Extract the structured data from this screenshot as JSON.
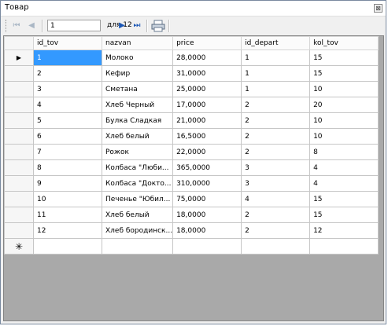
{
  "window": {
    "title": "Товар",
    "close_symbol": "⊠"
  },
  "navigator": {
    "position": "1",
    "count_label": "для 12",
    "buttons": {
      "first": "⏮",
      "prev": "◀",
      "next": "▶",
      "last": "⏭"
    }
  },
  "grid": {
    "columns": [
      "id_tov",
      "nazvan",
      "price",
      "id_depart",
      "kol_tov"
    ],
    "rows": [
      [
        "1",
        "Молоко",
        "28,0000",
        "1",
        "15"
      ],
      [
        "2",
        "Кефир",
        "31,0000",
        "1",
        "15"
      ],
      [
        "3",
        "Сметана",
        "25,0000",
        "1",
        "10"
      ],
      [
        "4",
        "Хлеб Черный",
        "17,0000",
        "2",
        "20"
      ],
      [
        "5",
        "Булка Сладкая",
        "21,0000",
        "2",
        "10"
      ],
      [
        "6",
        "Хлеб белый",
        "16,5000",
        "2",
        "10"
      ],
      [
        "7",
        "Рожок",
        "22,0000",
        "2",
        "8"
      ],
      [
        "8",
        "Колбаса \"Люби...",
        "365,0000",
        "3",
        "4"
      ],
      [
        "9",
        "Колбаса \"Докто...",
        "310,0000",
        "3",
        "4"
      ],
      [
        "10",
        "Печенье \"Юбил...",
        "75,0000",
        "4",
        "15"
      ],
      [
        "11",
        "Хлеб белый",
        "18,0000",
        "2",
        "15"
      ],
      [
        "12",
        "Хлеб бородинск...",
        "18,0000",
        "2",
        "12"
      ]
    ],
    "current_marker": "▶",
    "new_row_marker": "✳"
  },
  "colors": {
    "selection": "#3399ff",
    "empty_area": "#a9a9a9"
  }
}
